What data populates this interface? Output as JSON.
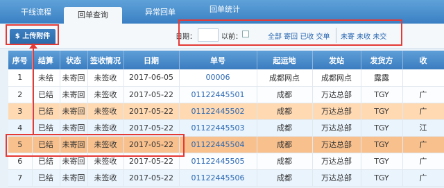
{
  "tabs": [
    {
      "label": "干线流程"
    },
    {
      "label": "回单查询"
    },
    {
      "label": "异常回单"
    },
    {
      "label": "回单统计"
    }
  ],
  "toolbar": {
    "upload_label": "$ 上传附件"
  },
  "filter": {
    "date_label": "日期：",
    "before_label": "以前：",
    "links_a": "全部 寄回 已收 交单",
    "links_b": "未寄 未收 未交"
  },
  "table": {
    "headers": [
      "序号",
      "结算",
      "状态",
      "签收情况",
      "日期",
      "单号",
      "起运地",
      "发站",
      "发货方",
      "收"
    ],
    "rows": [
      [
        "1",
        "未结",
        "未寄回",
        "未签收",
        "2017-06-05",
        "00006",
        "成都网点",
        "成都网点",
        "露露",
        ""
      ],
      [
        "2",
        "已结",
        "未寄回",
        "未签收",
        "2017-05-22",
        "01122445501",
        "成都",
        "万达总部",
        "TGY",
        "广"
      ],
      [
        "3",
        "已结",
        "未寄回",
        "未签收",
        "2017-05-22",
        "01122445502",
        "成都",
        "万达总部",
        "TGY",
        "广"
      ],
      [
        "4",
        "已结",
        "未寄回",
        "未签收",
        "2017-05-22",
        "01122445503",
        "成都",
        "万达总部",
        "TGY",
        "江"
      ],
      [
        "5",
        "已结",
        "未寄回",
        "未签收",
        "2017-05-22",
        "01122445504",
        "成都",
        "万达总部",
        "TGY",
        "广"
      ],
      [
        "6",
        "已结",
        "未寄回",
        "未签收",
        "2017-05-22",
        "01122445505",
        "成都",
        "万达总部",
        "TGY",
        "广"
      ],
      [
        "7",
        "已结",
        "未寄回",
        "未签收",
        "2017-05-22",
        "01122445506",
        "成都",
        "万达总部",
        "TGY",
        "广"
      ]
    ]
  }
}
